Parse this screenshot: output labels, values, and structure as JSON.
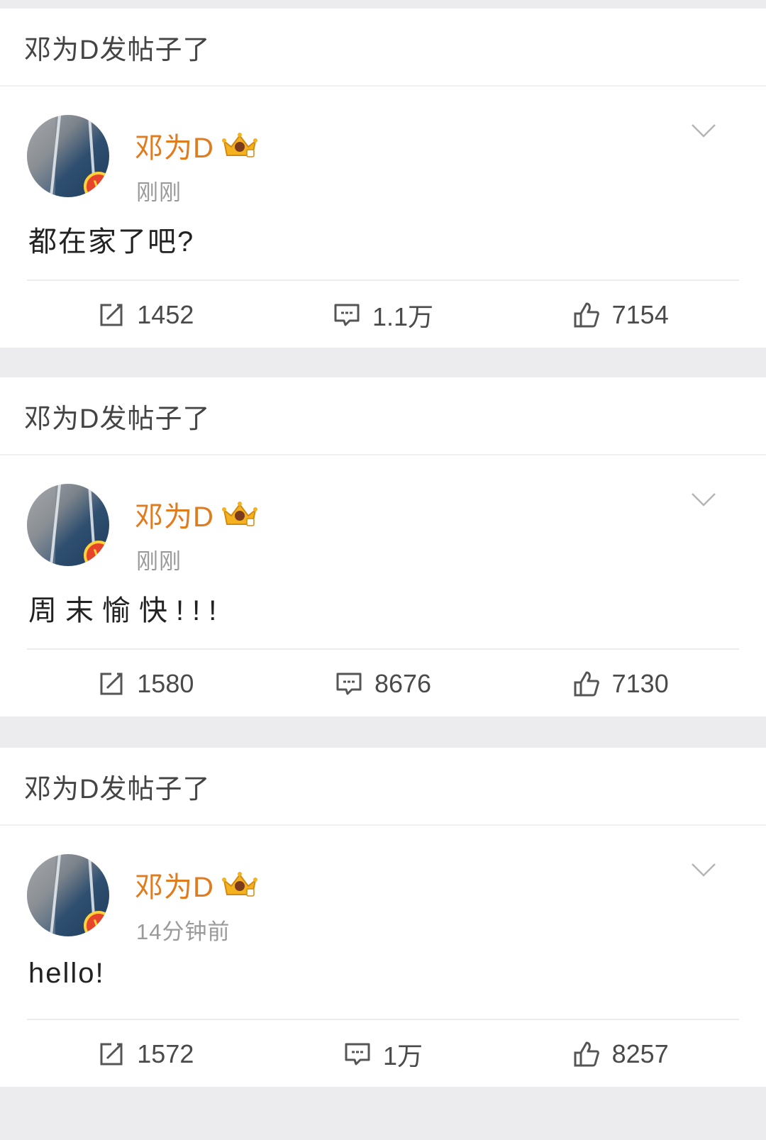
{
  "posts": [
    {
      "header": "邓为D发帖子了",
      "author": "邓为D",
      "time": "刚刚",
      "text": "都在家了吧?",
      "reposts": "1452",
      "comments": "1.1万",
      "likes": "7154"
    },
    {
      "header": "邓为D发帖子了",
      "author": "邓为D",
      "time": "刚刚",
      "text": "周末愉快!!!",
      "reposts": "1580",
      "comments": "8676",
      "likes": "7130"
    },
    {
      "header": "邓为D发帖子了",
      "author": "邓为D",
      "time": "14分钟前",
      "text": "hello!",
      "reposts": "1572",
      "comments": "1万",
      "likes": "8257"
    }
  ],
  "badges": {
    "verified_letter": "V"
  },
  "icons": {
    "repost": "repost-icon",
    "comment": "comment-icon",
    "like": "like-icon",
    "more": "chevron-down-icon",
    "crown": "crown-icon",
    "verified": "verified-badge-icon"
  },
  "colors": {
    "author_name": "#e07b1e",
    "verified_badge": "#e6452c",
    "background": "#ececee"
  }
}
